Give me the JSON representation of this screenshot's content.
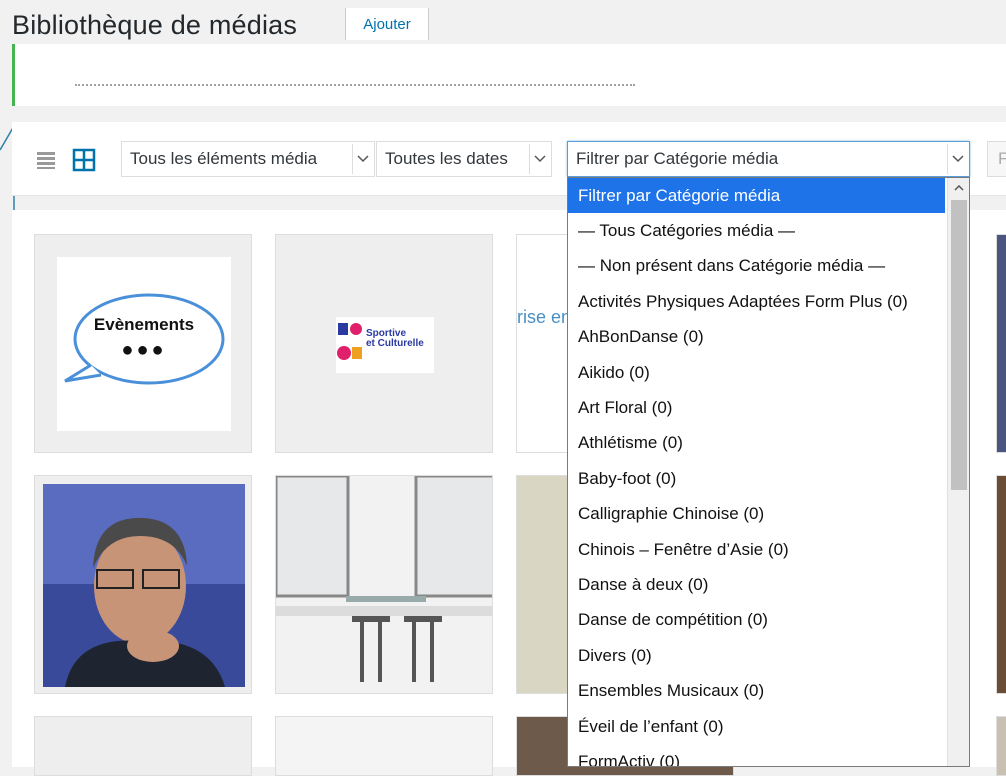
{
  "header": {
    "title": "Bibliothèque de médias",
    "add_label": "Ajouter"
  },
  "toolbar": {
    "type_filter": "Tous les éléments média",
    "date_filter": "Toutes les dates",
    "category_filter": "Filtrer par Catégorie média",
    "next_control": "F"
  },
  "grid": {
    "evenements_label": "Evènements",
    "evenements_dots": "●●●",
    "fsc_text": "Sportive\net Culturelle",
    "partial_text": "rise en"
  },
  "dropdown": {
    "items": [
      "Filtrer par Catégorie média",
      "— Tous Catégories média —",
      "— Non présent dans Catégorie média —",
      "Activités Physiques Adaptées Form Plus  (0)",
      "AhBonDanse  (0)",
      "Aikido  (0)",
      "Art Floral  (0)",
      "Athlétisme  (0)",
      "Baby-foot  (0)",
      "Calligraphie Chinoise  (0)",
      "Chinois – Fenêtre d’Asie  (0)",
      "Danse à deux  (0)",
      "Danse de compétition  (0)",
      "Divers  (0)",
      "Ensembles Musicaux  (0)",
      "Éveil de l’enfant  (0)",
      "FormActiv  (0)"
    ]
  },
  "colors": {
    "accent": "#0073aa",
    "selection": "#1e73e8",
    "notice_border": "#46b450"
  }
}
